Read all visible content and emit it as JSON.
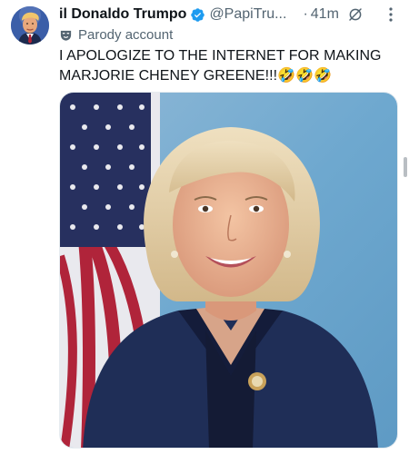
{
  "post": {
    "author": {
      "display_name": "il Donaldo Trumpo",
      "handle": "@PapiTru...",
      "verified": true,
      "avatar_icon": "user-avatar-photo"
    },
    "separator": "·",
    "timestamp": "41m",
    "parody_label": "Parody account",
    "text": "I APOLOGIZE TO THE INTERNET FOR MAKING MARJORIE CHENEY GREENE!!!🤣🤣🤣",
    "media": {
      "kind": "photo",
      "icon": "portrait-photo"
    }
  },
  "icons": {
    "verified": "verified-badge-icon",
    "grok": "grok-icon",
    "more": "more-options-icon",
    "parody": "parody-mask-icon"
  },
  "colors": {
    "verified_blue": "#1d9bf0",
    "text_primary": "#0f1419",
    "text_secondary": "#536471"
  }
}
